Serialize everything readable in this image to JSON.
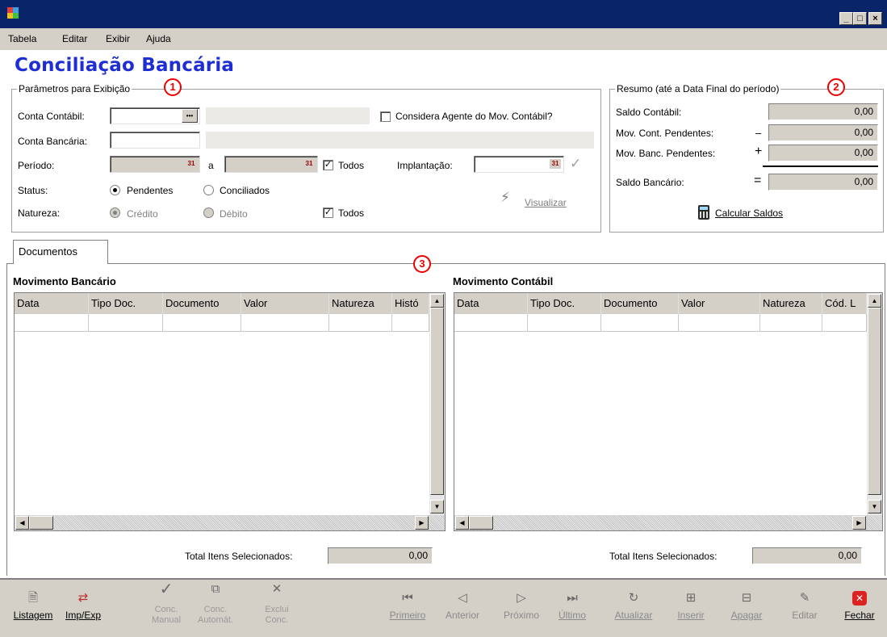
{
  "window": {
    "title": "",
    "min_glyph": "_",
    "max_glyph": "□",
    "close_glyph": "×"
  },
  "menu": [
    "Tabela",
    "Editar",
    "Exibir",
    "Ajuda"
  ],
  "page_title": "Conciliação Bancária",
  "params": {
    "legend": "Parâmetros para Exibição",
    "marker": "1",
    "conta_contabil_label": "Conta Contábil:",
    "lookup_glyph": "•••",
    "conta_bancaria_label": "Conta Bancária:",
    "periodo_label": "Período:",
    "periodo_sep": "a",
    "todos_label": "Todos",
    "implantacao_label": "Implantação:",
    "considera_label": "Considera Agente do Mov. Contábil?",
    "status_label": "Status:",
    "pendentes_label": "Pendentes",
    "conciliados_label": "Conciliados",
    "natureza_label": "Natureza:",
    "credito_label": "Crédito",
    "debito_label": "Débito",
    "natureza_todos_label": "Todos",
    "visualizar_label": "Visualizar",
    "check_glyph": "✓"
  },
  "resumo": {
    "legend": "Resumo (até a Data Final do período)",
    "marker": "2",
    "saldo_contabil_label": "Saldo Contábil:",
    "saldo_contabil_value": "0,00",
    "mov_cont_label": "Mov. Cont. Pendentes:",
    "mov_cont_op": "–",
    "mov_cont_value": "0,00",
    "mov_banc_label": "Mov. Banc. Pendentes:",
    "mov_banc_op": "+",
    "mov_banc_value": "0,00",
    "saldo_bancario_label": "Saldo Bancário:",
    "saldo_bancario_op": "=",
    "saldo_bancario_value": "0,00",
    "calcular_label": "Calcular Saldos"
  },
  "tabs": {
    "documentos": "Documentos",
    "marker": "3"
  },
  "bancario": {
    "title": "Movimento Bancário",
    "columns": [
      "Data",
      "Tipo Doc.",
      "Documento",
      "Valor",
      "Natureza",
      "Histó"
    ],
    "total_label": "Total Itens Selecionados:",
    "total_value": "0,00"
  },
  "contabil": {
    "title": "Movimento Contábil",
    "columns": [
      "Data",
      "Tipo Doc.",
      "Documento",
      "Valor",
      "Natureza",
      "Cód. L"
    ],
    "total_label": "Total Itens Selecionados:",
    "total_value": "0,00"
  },
  "toolbar": {
    "listagem": "Listagem",
    "impexp": "Imp/Exp",
    "conc_manual_1": "Conc.",
    "conc_manual_2": "Manual",
    "conc_auto_1": "Conc.",
    "conc_auto_2": "Automát.",
    "exclui_1": "Exclui",
    "exclui_2": "Conc.",
    "primeiro": "Primeiro",
    "anterior": "Anterior",
    "proximo": "Próximo",
    "ultimo": "Último",
    "atualizar": "Atualizar",
    "inserir": "Inserir",
    "apagar": "Apagar",
    "editar": "Editar",
    "fechar": "Fechar"
  },
  "colors": {
    "titlebar": "#0a246a",
    "title_text": "#1e2ed4",
    "marker": "#e00000",
    "face": "#d4d0c8"
  }
}
